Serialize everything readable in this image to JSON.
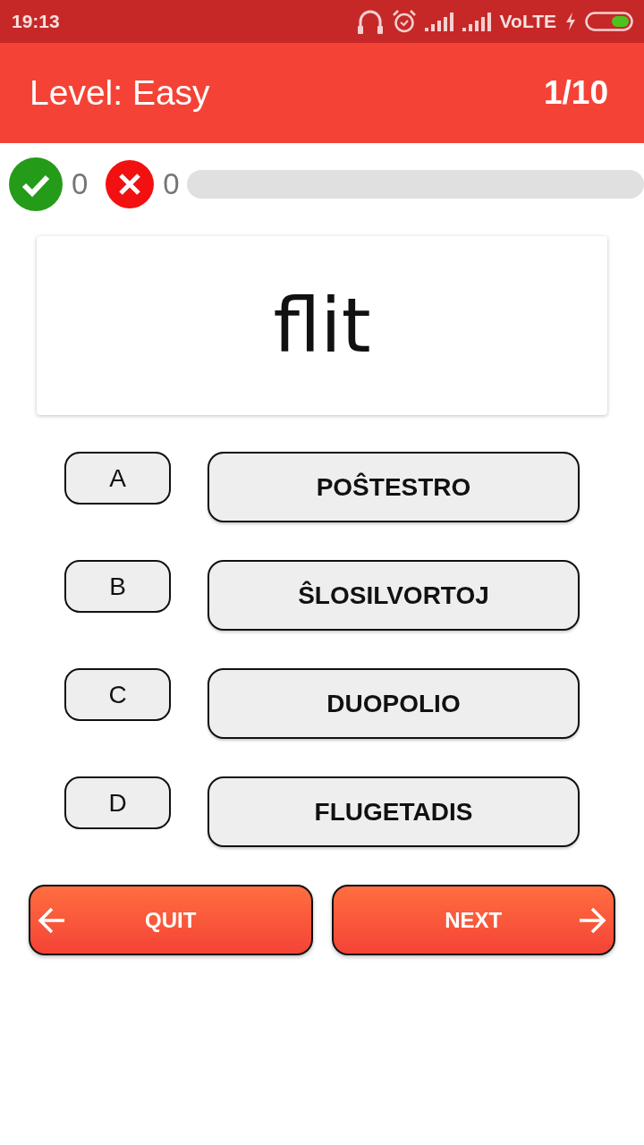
{
  "status_bar": {
    "time": "19:13",
    "network_label": "VoLTE"
  },
  "app_bar": {
    "title": "Level: Easy",
    "counter": "1/10"
  },
  "score": {
    "correct": "0",
    "wrong": "0",
    "progress": {
      "level": 0
    }
  },
  "question": {
    "word": "flit"
  },
  "options": [
    {
      "letter": "A",
      "answer": "POŜTESTRO",
      "selected": false
    },
    {
      "letter": "B",
      "answer": "ŜLOSILVORTOJ",
      "selected": false
    },
    {
      "letter": "C",
      "answer": "DUOPOLIO",
      "selected": false
    },
    {
      "letter": "D",
      "answer": "FLUGETADIS",
      "selected": false
    }
  ],
  "actions": [
    {
      "kind": "back",
      "label": "QUIT"
    },
    {
      "kind": "forward",
      "label": "NEXT"
    }
  ]
}
